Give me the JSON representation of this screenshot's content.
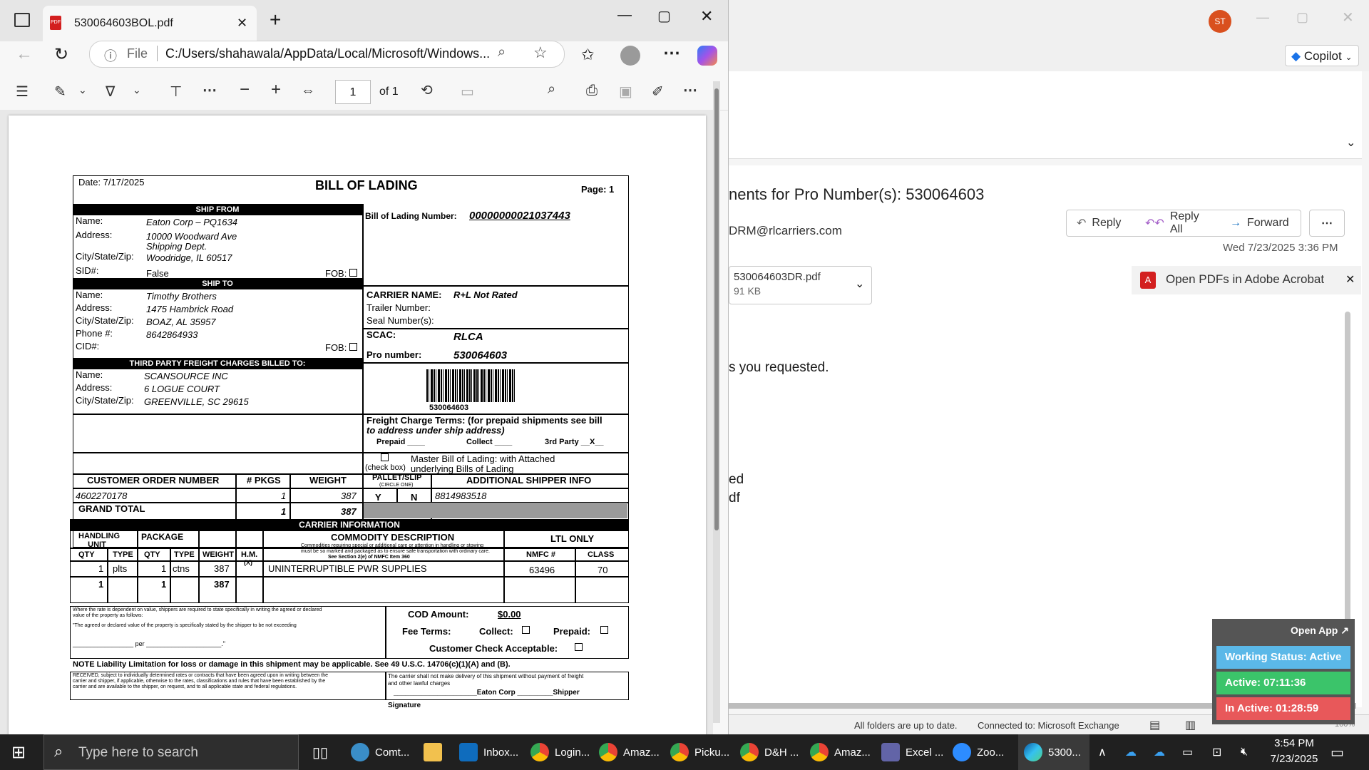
{
  "edge": {
    "tab_title": "530064603BOL.pdf",
    "address_scheme": "File",
    "address_url": "C:/Users/shahawala/AppData/Local/Microsoft/Windows...",
    "page_current": "1",
    "page_total": "of 1"
  },
  "bol": {
    "date": "Date: 7/17/2025",
    "title": "BILL OF LADING",
    "page": "Page: 1",
    "ship_from_bar": "SHIP FROM",
    "ship_to_bar": "SHIP TO",
    "third_party_bar": "THIRD PARTY FREIGHT CHARGES BILLED TO:",
    "from": {
      "name_label": "Name:",
      "name": "Eaton Corp – PQ1634",
      "address_label": "Address:",
      "address1": "10000 Woodward Ave",
      "address2": "Shipping Dept.",
      "csz_label": "City/State/Zip:",
      "csz": "Woodridge, IL 60517",
      "sid_label": "SID#:",
      "sid": "False",
      "fob_label": "FOB:"
    },
    "to": {
      "name_label": "Name:",
      "name": "Timothy Brothers",
      "address_label": "Address:",
      "address": "1475 Hambrick Road",
      "csz_label": "City/State/Zip:",
      "csz": "BOAZ, AL 35957",
      "phone_label": "Phone #:",
      "phone": "8642864933",
      "cid_label": "CID#:",
      "fob_label": "FOB:"
    },
    "third": {
      "name_label": "Name:",
      "name": "SCANSOURCE INC",
      "address_label": "Address:",
      "address": "6 LOGUE COURT",
      "csz_label": "City/State/Zip:",
      "csz": "GREENVILLE, SC 29615"
    },
    "bol_number_label": "Bill of Lading Number:",
    "bol_number": "00000000021037443",
    "carrier_name_label": "CARRIER NAME:",
    "carrier_name": "R+L Not Rated",
    "trailer_label": "Trailer Number:",
    "seal_label": "Seal Number(s):",
    "scac_label": "SCAC:",
    "scac": "RLCA",
    "pro_label": "Pro number:",
    "pro": "530064603",
    "barcode_text": "530064603",
    "freight_terms_line1": "Freight Charge Terms: (for prepaid shipments see bill",
    "freight_terms_line2": "to address under ship address)",
    "prepaid": "Prepaid ____",
    "collect": "Collect ____",
    "third_party": "3rd Party __X__",
    "master_line1": "Master Bill of Lading: with Attached",
    "master_check": "(check box)",
    "master_line2": "underlying Bills of Lading",
    "order_headers": [
      "CUSTOMER ORDER NUMBER",
      "# PKGS",
      "WEIGHT",
      "PALLET/SLIP",
      "ADDITIONAL SHIPPER INFO"
    ],
    "circle_one": "(CIRCLE ONE)",
    "order_row": {
      "order": "4602270178",
      "pkgs": "1",
      "weight": "387",
      "y": "Y",
      "n": "N",
      "info": "8814983518"
    },
    "grand_total_label": "GRAND TOTAL",
    "grand_total_pkgs": "1",
    "grand_total_weight": "387",
    "carrier_info_bar": "CARRIER INFORMATION",
    "handling_unit": "HANDLING UNIT",
    "package": "PACKAGE",
    "commodity": "COMMODITY DESCRIPTION",
    "ltl_only": "LTL ONLY",
    "commodity_note1": "Commodities requiring special or additional care or attention in handling or stowing",
    "commodity_note2": "must be so marked and packaged as to ensure safe transportation with ordinary care.",
    "commodity_note3": "See Section 2(e) of NMFC Item 360",
    "col_qty": "QTY",
    "col_type": "TYPE",
    "col_weight": "WEIGHT",
    "col_hm": "H.M.",
    "col_hm_x": "(X)",
    "col_nmfc": "NMFC #",
    "col_class": "CLASS",
    "carrier_row": {
      "hu_qty": "1",
      "hu_type": "plts",
      "pkg_qty": "1",
      "pkg_type": "ctns",
      "weight": "387",
      "desc": "UNINTERRUPTIBLE PWR SUPPLIES",
      "nmfc": "63496",
      "class": "70"
    },
    "carrier_total": {
      "hu_qty": "1",
      "pkg_qty": "1",
      "weight": "387"
    },
    "value_note1": "Where the rate is dependent on value, shippers are required to state specifically in writing the agreed or declared",
    "value_note2": "value of the property as follows:",
    "value_note3": "\"The agreed or declared value of the property is specifically stated by the shipper to be not exceeding",
    "value_note4": "_________________ per _____________________.\"",
    "cod_label": "COD Amount:",
    "cod_value": "$0.00",
    "fee_terms": "Fee Terms:",
    "fee_collect": "Collect:",
    "fee_prepaid": "Prepaid:",
    "customer_check": "Customer Check Acceptable:",
    "note_liability": "NOTE  Liability Limitation for loss or damage in this shipment may be applicable.  See 49 U.S.C. 14706(c)(1)(A) and (B).",
    "received_note1": "RECEIVED, subject to individually determined rates or contracts that have been agreed upon in writing between the",
    "received_note2": "carrier and shipper, if applicable, otherwise to the rates, classifications and rules that have been established by the",
    "received_note3": "carrier and are available to the shipper, on request, and to all applicable state and federal regulations.",
    "carrier_note1": "The carrier shall not make delivery of this shipment without payment of freight",
    "carrier_note2": "and other lawful charges",
    "eaton_shipper": "_____________________Eaton Corp _________Shipper",
    "signature": "Signature"
  },
  "outlook": {
    "avatar": "ST",
    "copilot": "Copilot",
    "subject": "nents for Pro Number(s): 530064603",
    "from": "DRM@rlcarriers.com",
    "reply": "Reply",
    "reply_all": "Reply All",
    "forward": "Forward",
    "date": "Wed 7/23/2025 3:36 PM",
    "attachment_name": "530064603DR.pdf",
    "attachment_size": "91 KB",
    "open_pdfs": "Open PDFs in Adobe Acrobat",
    "body_line": "s you requested.",
    "body_frag1": "ed",
    "body_frag2": "df",
    "status_folders": "All folders are up to date.",
    "status_connected": "Connected to: Microsoft Exchange",
    "zoom": "100%"
  },
  "widget": {
    "open_app": "Open App",
    "working": "Working Status: Active",
    "active": "Active: 07:11:36",
    "inactive": "In Active: 01:28:59"
  },
  "taskbar": {
    "search_placeholder": "Type here to search",
    "items": [
      "Comt...",
      "Inbox...",
      "Login...",
      "Amaz...",
      "Picku...",
      "D&H ...",
      "Amaz...",
      "Excel ...",
      "Zoo...",
      "5300..."
    ],
    "time": "3:54 PM",
    "date": "7/23/2025"
  },
  "colors": {
    "outlook_accent": "#0f6cbd",
    "widget_blue": "#5bb8e8",
    "widget_green": "#3bc46a",
    "widget_red": "#e8585a",
    "taskbar": "#202020"
  }
}
